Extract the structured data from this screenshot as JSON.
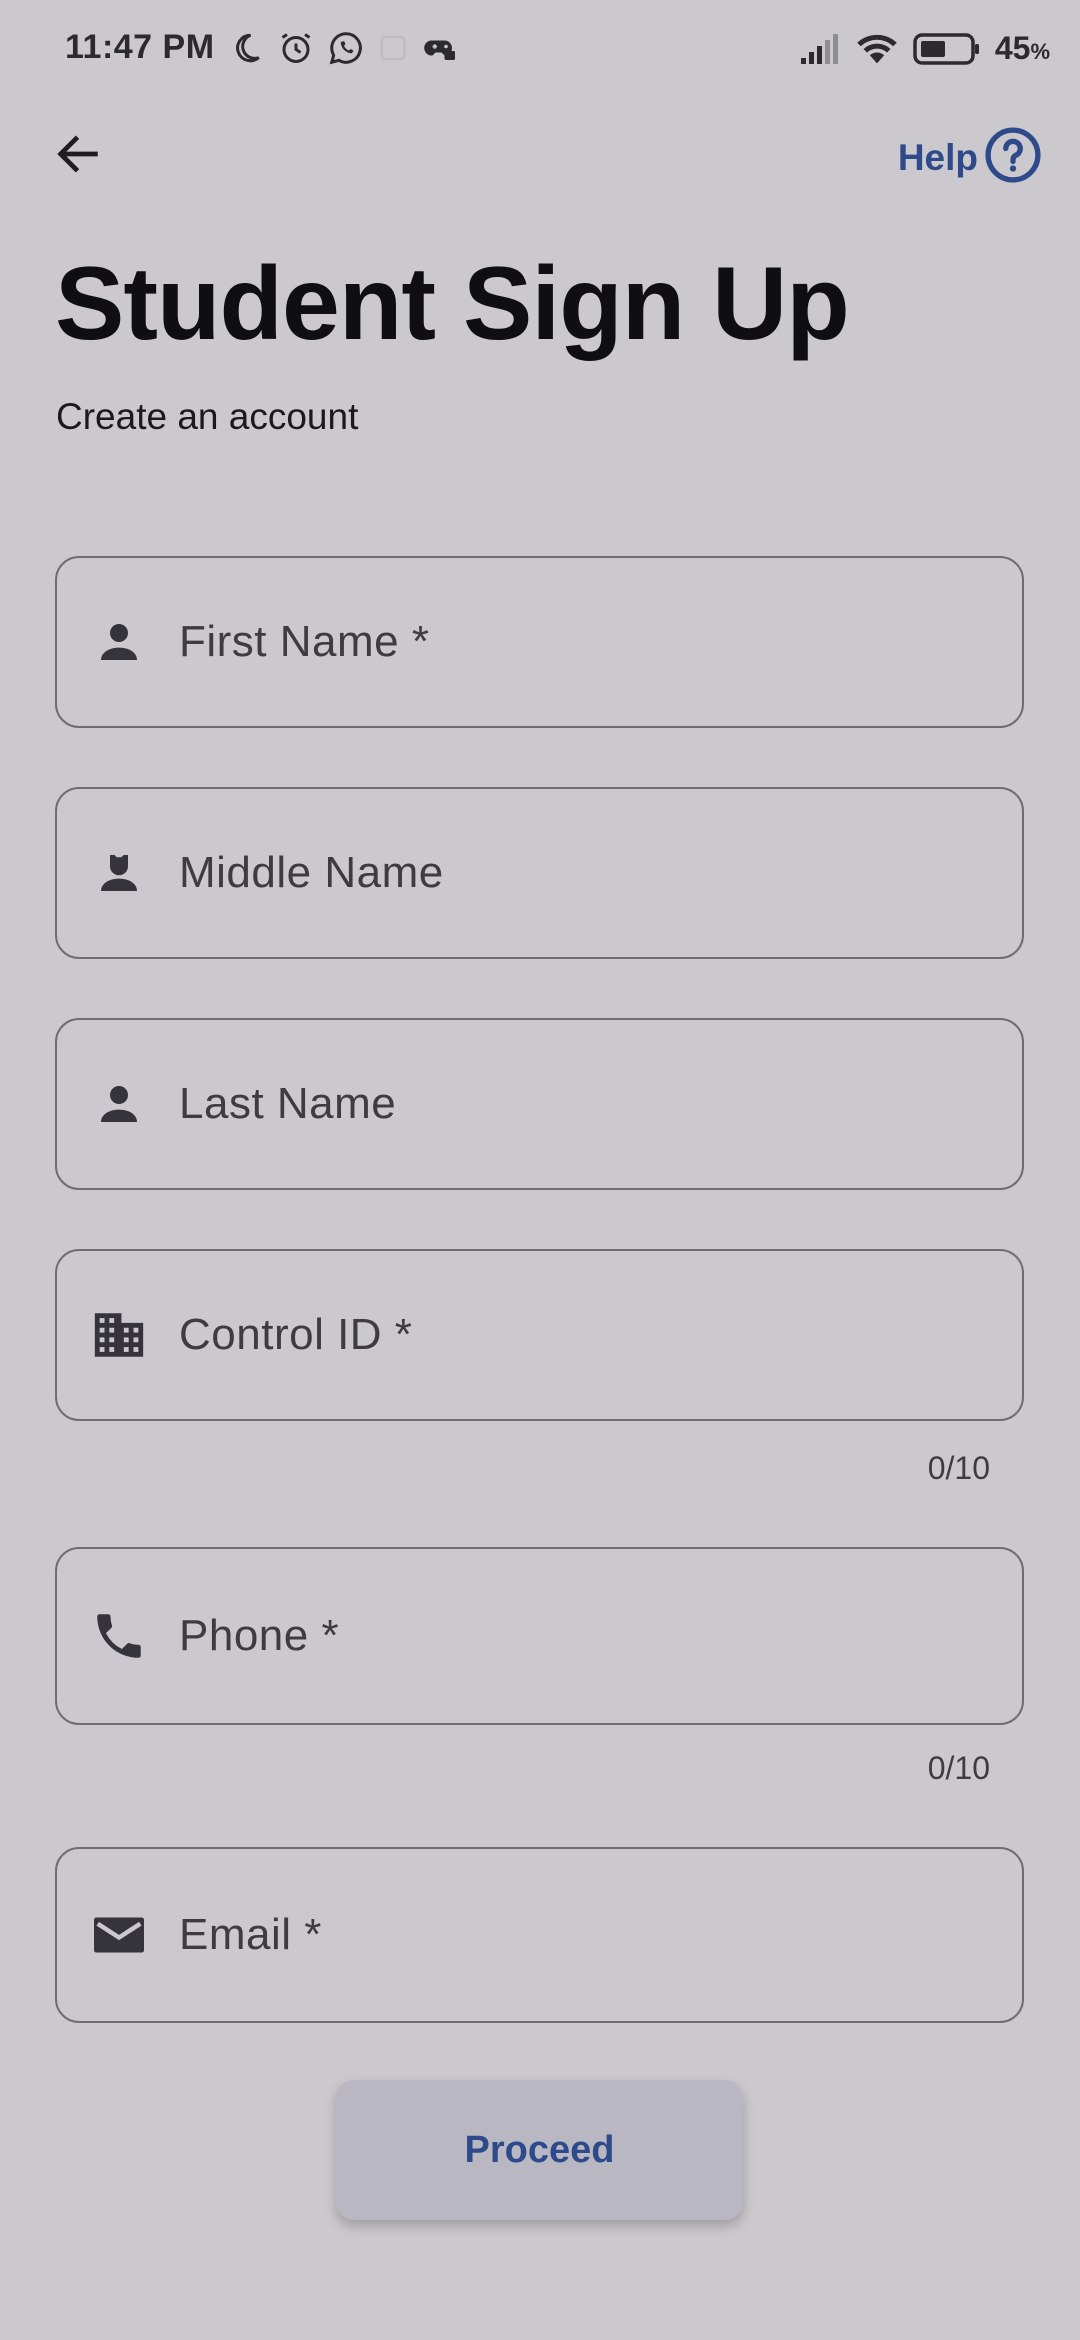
{
  "status_bar": {
    "time": "11:47 PM",
    "battery_percent": "45",
    "battery_unit": "%",
    "battery_level": 0.45,
    "icons_left": [
      "moon-icon",
      "alarm-icon",
      "whatsapp-icon",
      "notification-icon",
      "game-controller-icon"
    ],
    "icons_right": [
      "signal-icon",
      "wifi-icon",
      "battery-icon"
    ]
  },
  "top_bar": {
    "help_label": "Help",
    "icons": [
      "back-arrow-icon",
      "help-circle-icon"
    ]
  },
  "header": {
    "title": "Student Sign Up",
    "subtitle": "Create an account"
  },
  "form": {
    "fields": [
      {
        "placeholder": "First Name *",
        "icon": "person-icon"
      },
      {
        "placeholder": "Middle Name",
        "icon": "person-outline-icon"
      },
      {
        "placeholder": "Last Name",
        "icon": "person-icon"
      },
      {
        "placeholder": "Control ID *",
        "icon": "building-icon",
        "counter": "0/10"
      },
      {
        "placeholder": "Phone *",
        "icon": "phone-icon",
        "counter": "0/10"
      },
      {
        "placeholder": "Email *",
        "icon": "email-icon"
      }
    ]
  },
  "actions": {
    "proceed_label": "Proceed"
  },
  "colors": {
    "background": "#cbc9cd",
    "accent": "#2f4a8a",
    "field_border": "#6e6d72",
    "icon": "#35343a",
    "button_bg": "#b9b8c2"
  }
}
